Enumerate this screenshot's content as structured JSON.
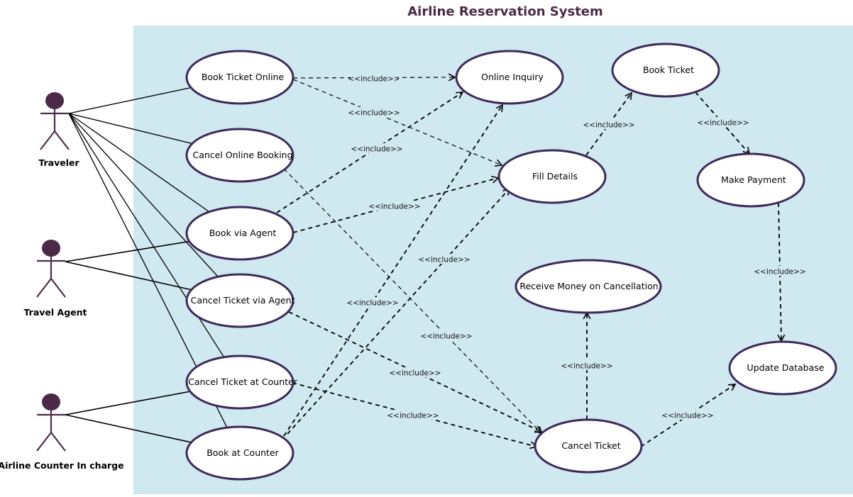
{
  "title": "Airline Reservation System",
  "colors": {
    "boundary_fill": "#d0e8ef",
    "actor": "#4a2d48",
    "actor_head": "#4b2a47",
    "usecase_stroke": "#3d2a5a",
    "usecase_fill": "#ffffff",
    "title": "#4b2a47",
    "line": "#000000"
  },
  "actors": [
    {
      "id": "traveler",
      "label": "Traveler"
    },
    {
      "id": "agent",
      "label": "Travel Agent"
    },
    {
      "id": "counter",
      "label": "Airline Counter In charge"
    }
  ],
  "use_cases": [
    {
      "id": "book_online",
      "label": "Book Ticket Online"
    },
    {
      "id": "cancel_online",
      "label": "Cancel Online Booking"
    },
    {
      "id": "book_agent",
      "label": "Book via Agent"
    },
    {
      "id": "cancel_agent",
      "label": "Cancel Ticket via Agent"
    },
    {
      "id": "cancel_counter",
      "label": "Cancel Ticket at Counter"
    },
    {
      "id": "book_counter",
      "label": "Book at Counter"
    },
    {
      "id": "online_inquiry",
      "label": "Online Inquiry"
    },
    {
      "id": "fill_details",
      "label": "Fill Details"
    },
    {
      "id": "book_ticket",
      "label": "Book Ticket"
    },
    {
      "id": "make_payment",
      "label": "Make Payment"
    },
    {
      "id": "receive_money",
      "label": "Receive Money on Cancellation"
    },
    {
      "id": "update_db",
      "label": "Update Database"
    },
    {
      "id": "cancel_ticket",
      "label": "Cancel Ticket"
    }
  ],
  "associations": [
    {
      "actor": "traveler",
      "use_case": "book_online"
    },
    {
      "actor": "traveler",
      "use_case": "cancel_online"
    },
    {
      "actor": "traveler",
      "use_case": "book_agent"
    },
    {
      "actor": "traveler",
      "use_case": "cancel_agent"
    },
    {
      "actor": "traveler",
      "use_case": "cancel_counter"
    },
    {
      "actor": "traveler",
      "use_case": "book_counter"
    },
    {
      "actor": "agent",
      "use_case": "book_agent"
    },
    {
      "actor": "agent",
      "use_case": "cancel_agent"
    },
    {
      "actor": "counter",
      "use_case": "cancel_counter"
    },
    {
      "actor": "counter",
      "use_case": "book_counter"
    }
  ],
  "include_label": "<<include>>",
  "includes": [
    {
      "from": "book_online",
      "to": "online_inquiry"
    },
    {
      "from": "book_online",
      "to": "fill_details"
    },
    {
      "from": "book_agent",
      "to": "online_inquiry"
    },
    {
      "from": "book_agent",
      "to": "fill_details"
    },
    {
      "from": "book_counter",
      "to": "online_inquiry"
    },
    {
      "from": "book_counter",
      "to": "fill_details"
    },
    {
      "from": "cancel_online",
      "to": "cancel_ticket"
    },
    {
      "from": "cancel_agent",
      "to": "cancel_ticket"
    },
    {
      "from": "cancel_counter",
      "to": "cancel_ticket"
    },
    {
      "from": "fill_details",
      "to": "book_ticket"
    },
    {
      "from": "book_ticket",
      "to": "make_payment"
    },
    {
      "from": "make_payment",
      "to": "update_db"
    },
    {
      "from": "cancel_ticket",
      "to": "receive_money"
    },
    {
      "from": "cancel_ticket",
      "to": "update_db"
    }
  ]
}
